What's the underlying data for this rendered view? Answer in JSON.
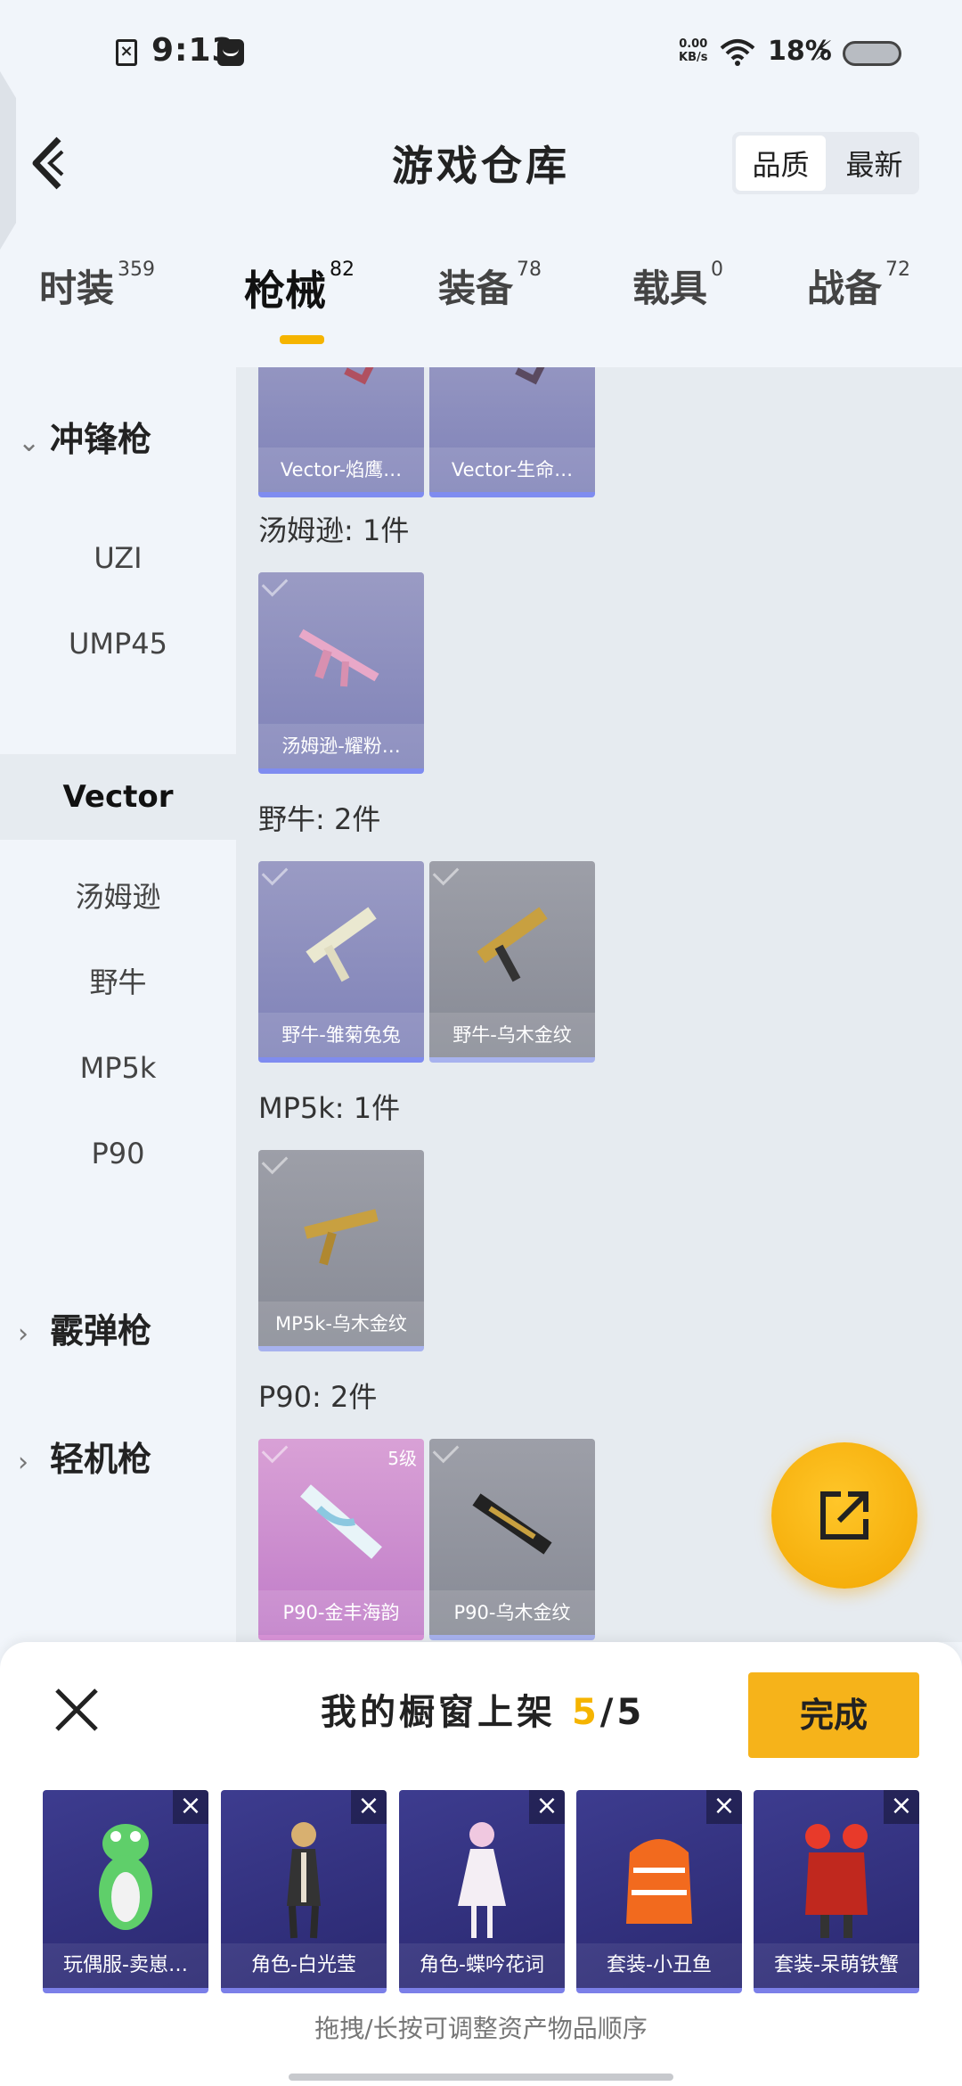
{
  "status_bar": {
    "time": "9:13",
    "speed": "0.00\nKB/s",
    "battery": "18%"
  },
  "header": {
    "title": "游戏仓库",
    "sort_options": [
      "品质",
      "最新"
    ]
  },
  "tabs": [
    {
      "label": "时装",
      "count": "359"
    },
    {
      "label": "枪械",
      "count": "82"
    },
    {
      "label": "装备",
      "count": "78"
    },
    {
      "label": "载具",
      "count": "0"
    },
    {
      "label": "战备",
      "count": "72"
    }
  ],
  "sidebar": {
    "categories": [
      "冲锋枪",
      "霰弹枪",
      "轻机枪"
    ],
    "sub_items": [
      "UZI",
      "UMP45",
      "Vector",
      "汤姆逊",
      "野牛",
      "MP5k",
      "P90"
    ]
  },
  "content": {
    "top_cards": [
      "Vector-焰鹰…",
      "Vector-生命…"
    ],
    "groups": [
      {
        "label": "汤姆逊: 1件",
        "cards": [
          "汤姆逊-耀粉…"
        ]
      },
      {
        "label": "野牛: 2件",
        "cards": [
          "野牛-雏菊兔兔",
          "野牛-乌木金纹"
        ]
      },
      {
        "label": "MP5k: 1件",
        "cards": [
          "MP5k-乌木金纹"
        ]
      },
      {
        "label": "P90: 2件",
        "cards": [
          "P90-金丰海韵",
          "P90-乌木金纹"
        ],
        "level": "5级"
      }
    ]
  },
  "sheet": {
    "title_prefix": "我的橱窗上架 ",
    "count": "5",
    "total": "/5",
    "done_label": "完成",
    "slots": [
      "玩偶服-卖崽…",
      "角色-白光莹",
      "角色-蝶吟花词",
      "套装-小丑鱼",
      "套装-呆萌铁蟹"
    ],
    "hint": "拖拽/长按可调整资产物品顺序"
  }
}
